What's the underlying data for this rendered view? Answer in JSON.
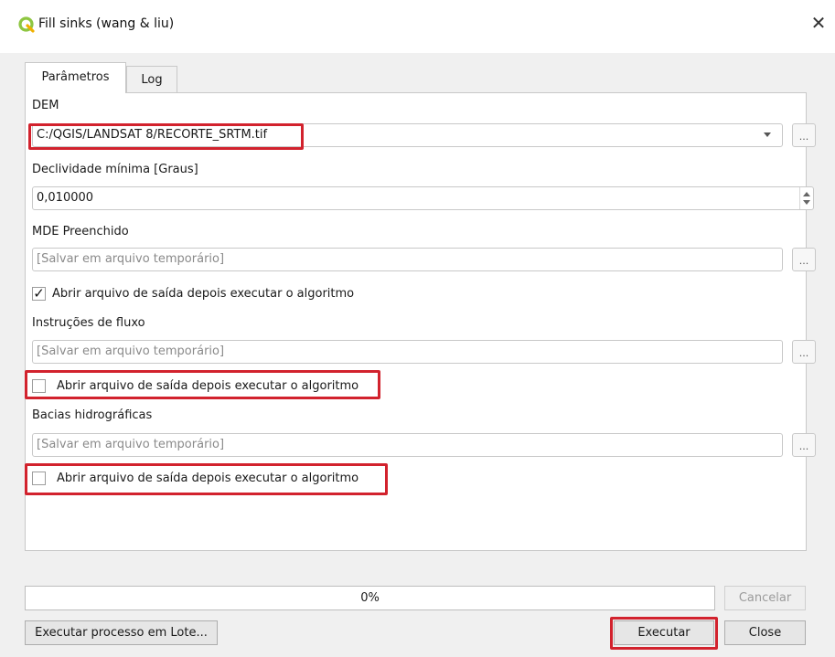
{
  "window": {
    "title": "Fill sinks (wang & liu)",
    "close_icon": "close-icon",
    "logo_icon": "qgis-logo-icon"
  },
  "tabs": [
    {
      "label": "Parâmetros",
      "active": true
    },
    {
      "label": "Log",
      "active": false
    }
  ],
  "params": {
    "dem": {
      "label": "DEM",
      "value": "C:/QGIS/LANDSAT 8/RECORTE_SRTM.tif",
      "browse_label": "..."
    },
    "declividade": {
      "label": "Declividade mínima [Graus]",
      "value": "0,010000"
    },
    "mde": {
      "label": "MDE Preenchido",
      "placeholder": "[Salvar em arquivo temporário]",
      "browse_label": "...",
      "open_checkbox_label": "Abrir arquivo de saída depois executar o algoritmo",
      "open_checked": true
    },
    "fluxo": {
      "label": "Instruções de fluxo",
      "placeholder": "[Salvar em arquivo temporário]",
      "browse_label": "...",
      "open_checkbox_label": "Abrir arquivo de saída depois executar o algoritmo",
      "open_checked": false
    },
    "bacias": {
      "label": "Bacias hidrográficas",
      "placeholder": "[Salvar em arquivo temporário]",
      "browse_label": "...",
      "open_checkbox_label": "Abrir arquivo de saída depois executar o algoritmo",
      "open_checked": false
    }
  },
  "progress": {
    "text": "0%",
    "value": 0
  },
  "buttons": {
    "cancel": "Cancelar",
    "batch": "Executar processo em Lote...",
    "run": "Executar",
    "close": "Close"
  },
  "colors": {
    "highlight": "#d2222d",
    "qgis_green": "#8ec641"
  }
}
